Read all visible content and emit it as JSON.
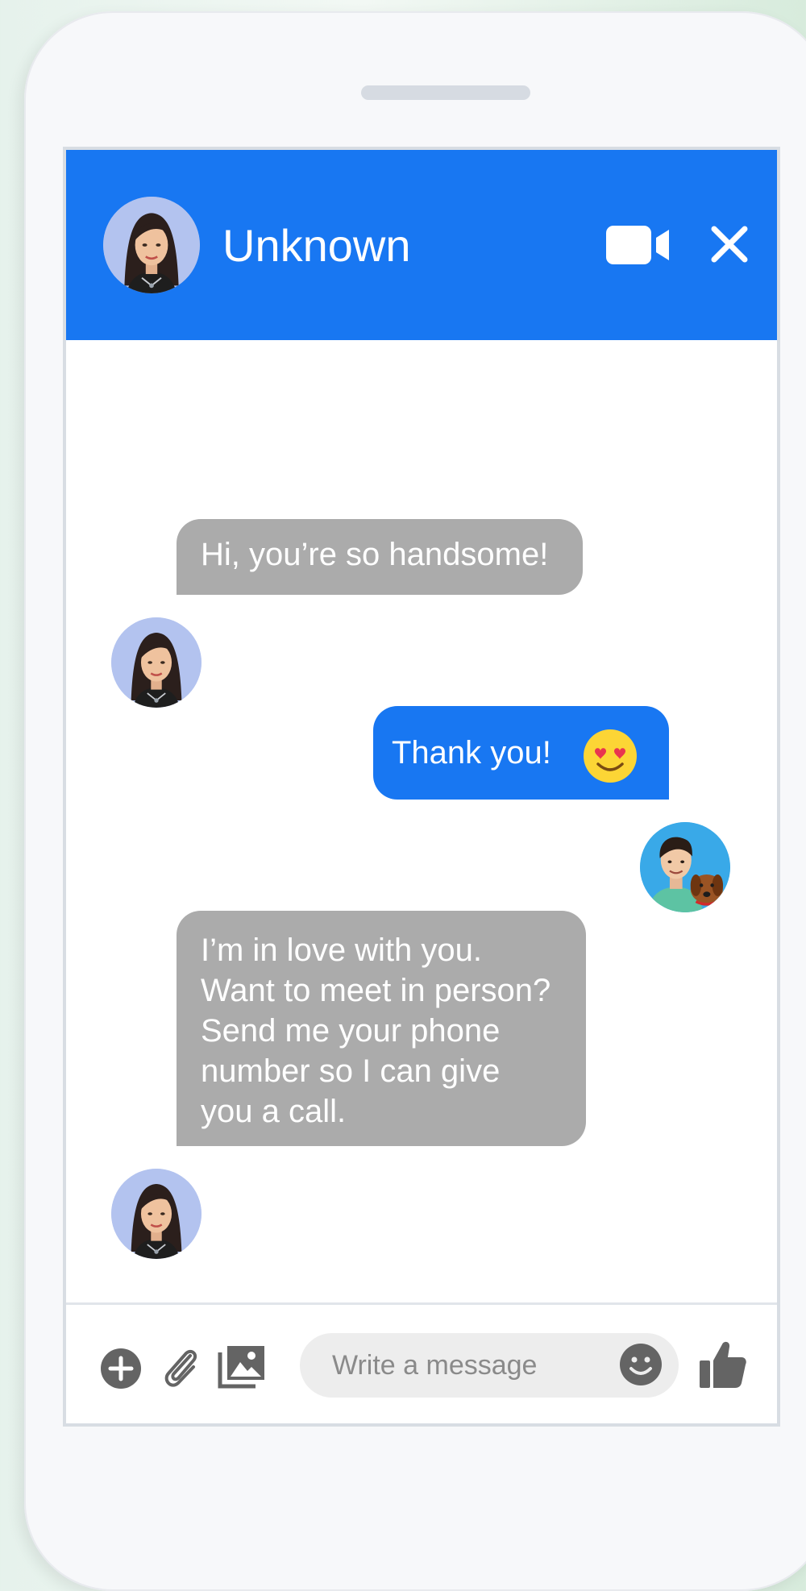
{
  "header": {
    "contact_name": "Unknown",
    "icons": {
      "video": "video-camera-icon",
      "close": "close-icon"
    }
  },
  "messages": [
    {
      "sender": "contact",
      "text": "Hi, you’re so handsome!"
    },
    {
      "sender": "me",
      "text": "Thank you!",
      "emoji": "heart-eyes-emoji"
    },
    {
      "sender": "contact",
      "lines": [
        "I’m in love with you.",
        "Want to meet in person?",
        "Send me your phone",
        "number so I can give",
        "you a call."
      ]
    }
  ],
  "composer": {
    "placeholder": "Write a message",
    "icons": [
      "plus-icon",
      "paperclip-icon",
      "image-icon",
      "smiley-icon",
      "thumbs-up-icon"
    ]
  },
  "colors": {
    "accent": "#1877f2",
    "incoming_bubble": "#ababab",
    "avatar_background": "#b3c3ef"
  }
}
